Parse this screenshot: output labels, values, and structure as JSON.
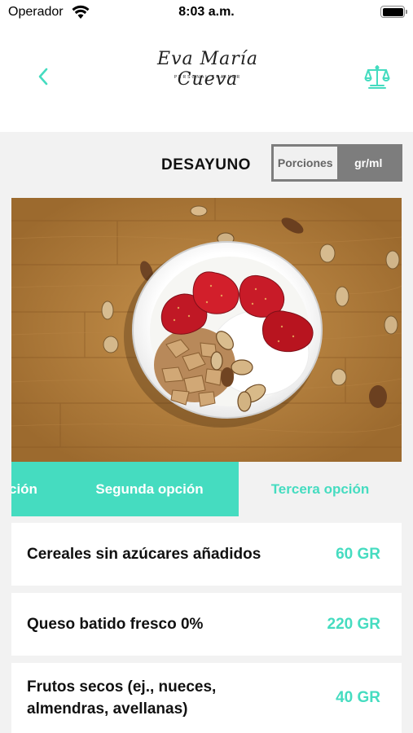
{
  "status_bar": {
    "carrier": "Operador",
    "time": "8:03 a.m."
  },
  "header": {
    "logo_script": "Eva María Cueva",
    "logo_subtitle": "PERSONAL TRAINER",
    "back_icon": "chevron-left-icon",
    "scale_icon": "balance-scale-icon",
    "accent_color": "#45dcc0"
  },
  "meal": {
    "title": "DESAYUNO",
    "unit_toggle": {
      "options": [
        "Porciones",
        "gr/ml"
      ],
      "selected": "gr/ml"
    }
  },
  "tabs": [
    {
      "label": "ción",
      "active": false
    },
    {
      "label": "Segunda opción",
      "active": true
    },
    {
      "label": "Tercera opción",
      "active": false
    }
  ],
  "foods": [
    {
      "name": "Cereales sin azúcares añadidos",
      "qty": "60 GR"
    },
    {
      "name": "Queso batido fresco 0%",
      "qty": "220 GR"
    },
    {
      "name": "Frutos secos (ej., nueces, almendras, avellanas)",
      "qty": "40 GR"
    }
  ]
}
